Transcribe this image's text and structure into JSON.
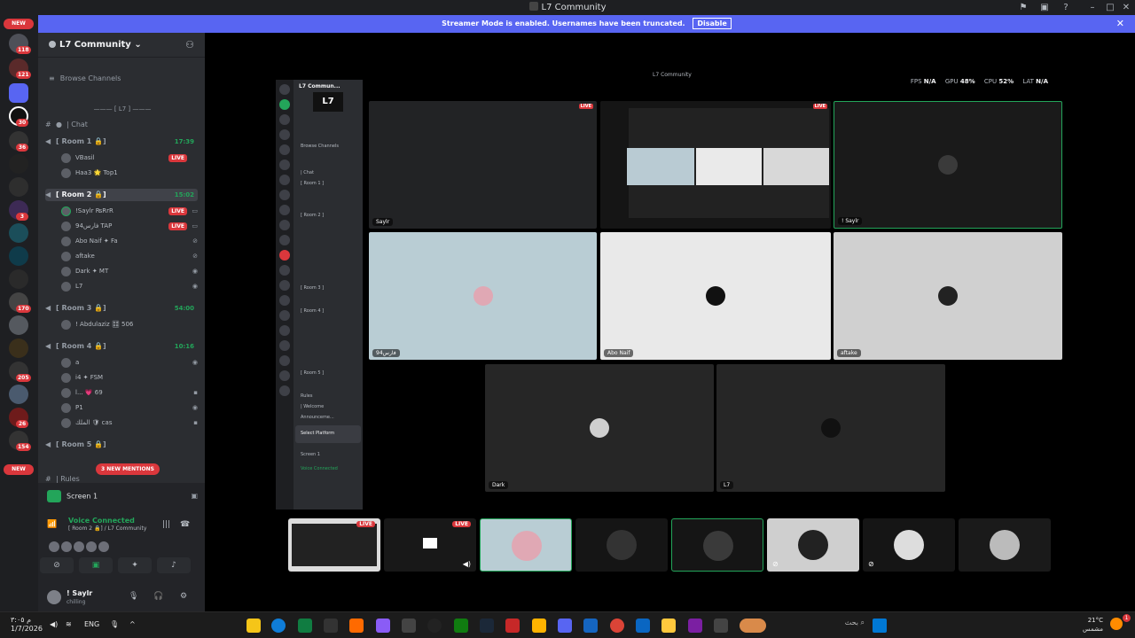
{
  "window": {
    "title": "L7 Community"
  },
  "banner": {
    "text": "Streamer Mode is enabled. Usernames have been truncated.",
    "disable_label": "Disable"
  },
  "rail": {
    "new_top": "NEW",
    "new_bottom": "NEW",
    "badges": [
      "118",
      "121",
      "30",
      "36",
      "3",
      "170",
      "205",
      "26",
      "154"
    ]
  },
  "server": {
    "name": "L7 Community",
    "browse": "Browse Channels",
    "category": "[ L7 ]",
    "chat": "| Chat",
    "rooms": [
      {
        "name": "[ Room 1 🔒]",
        "timer": "17:39"
      },
      {
        "name": "[ Room 2 🔒]",
        "timer": "15:02"
      },
      {
        "name": "[ Room 3 🔒]",
        "timer": "54:00"
      },
      {
        "name": "[ Room 4 🔒]",
        "timer": "10:16"
      },
      {
        "name": "[ Room 5 🔒]",
        "timer": ""
      }
    ],
    "room1_users": [
      "VBasil",
      "Haa3 🌟 Top1"
    ],
    "room2_users": [
      "!Saylr ₨RrR",
      "94فارس TAP",
      "Abo Naif ✦ Fa",
      "aftake",
      "Dark ✦ MT",
      "L7"
    ],
    "room3_users": [
      "! Abdulaziz 🎛 506"
    ],
    "room4_users": [
      "a",
      "i4 ✦ FSM",
      "l... 💗 69",
      "P1",
      "الملك 🛡 cas"
    ],
    "more_channel": "| Rules",
    "mentions": "3 NEW MENTIONS",
    "live": "LIVE"
  },
  "voice": {
    "screen_label": "Screen 1",
    "status": "Voice Connected",
    "location": "[ Room 2 🔒] / L7 Community",
    "username": "! Saylr",
    "user_status": "chilling"
  },
  "stats": {
    "fps_label": "FPS",
    "fps": "N/A",
    "gpu_label": "GPU",
    "gpu": "48%",
    "cpu_label": "CPU",
    "cpu": "52%",
    "lat_label": "LAT",
    "lat": "N/A"
  },
  "stream": {
    "inner_title": "L7 Community",
    "nested": {
      "server": "L7 Commun...",
      "logo": "L7",
      "browse": "Browse Channels",
      "chat": "| Chat",
      "room1": "[ Room 1 ]",
      "room2": "[ Room 2 ]",
      "room3": "[ Room 3 ]",
      "room4": "[ Room 4 ]",
      "room5": "[ Room 5 ]",
      "rules": "Rules",
      "welcome": "| Welcome",
      "announce": "Announceme...",
      "select_platform": "Select Platform",
      "screen": "Screen 1",
      "voice_connected": "Voice Connected"
    },
    "tiles": [
      {
        "name": "Saylr"
      },
      {
        "name": ""
      },
      {
        "name": "! Saylr"
      },
      {
        "name": "فارس94"
      },
      {
        "name": "Abo Naif"
      },
      {
        "name": "aftake"
      },
      {
        "name": "Dark"
      },
      {
        "name": "L7"
      }
    ]
  },
  "taskbar": {
    "time": "م ٣:٠٥",
    "date": "1/7/2026",
    "lang": "ENG",
    "search": "بحث",
    "temp": "21°C",
    "weather": "مشمس",
    "weather_badge": "1"
  }
}
